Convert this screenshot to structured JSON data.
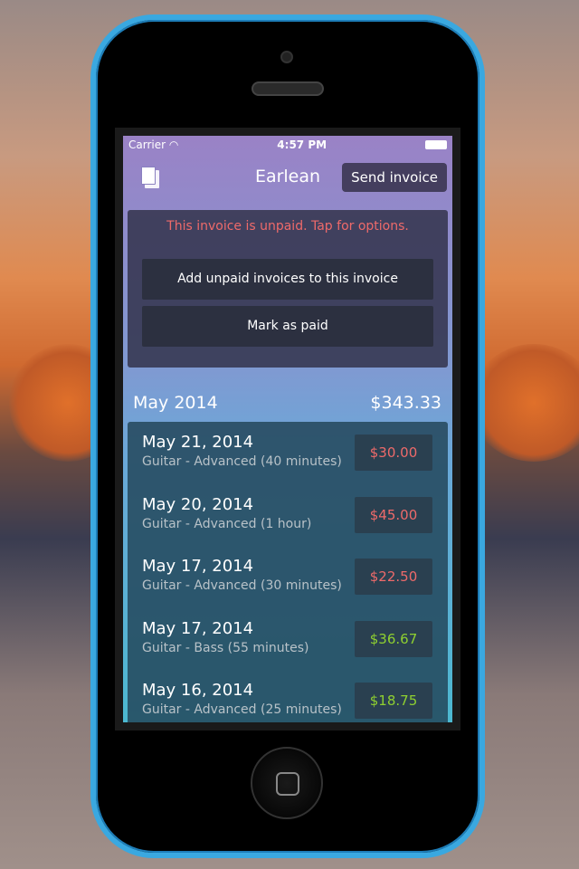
{
  "status": {
    "carrier": "Carrier",
    "time": "4:57 PM"
  },
  "nav": {
    "title": "Earlean",
    "send": "Send invoice"
  },
  "alert": {
    "message": "This invoice is unpaid. Tap for options.",
    "add_unpaid": "Add unpaid invoices to this invoice",
    "mark_paid": "Mark as paid"
  },
  "month": {
    "label": "May 2014",
    "total": "$343.33"
  },
  "colors": {
    "unpaid": "#ee6a6a",
    "paid": "#8fd030"
  },
  "items": [
    {
      "date": "May 21, 2014",
      "desc": "Guitar - Advanced (40 minutes)",
      "price": "$30.00",
      "paid": false
    },
    {
      "date": "May 20, 2014",
      "desc": "Guitar - Advanced (1 hour)",
      "price": "$45.00",
      "paid": false
    },
    {
      "date": "May 17, 2014",
      "desc": "Guitar - Advanced (30 minutes)",
      "price": "$22.50",
      "paid": false
    },
    {
      "date": "May 17, 2014",
      "desc": "Guitar - Bass (55 minutes)",
      "price": "$36.67",
      "paid": true
    },
    {
      "date": "May 16, 2014",
      "desc": "Guitar - Advanced (25 minutes)",
      "price": "$18.75",
      "paid": true
    }
  ]
}
